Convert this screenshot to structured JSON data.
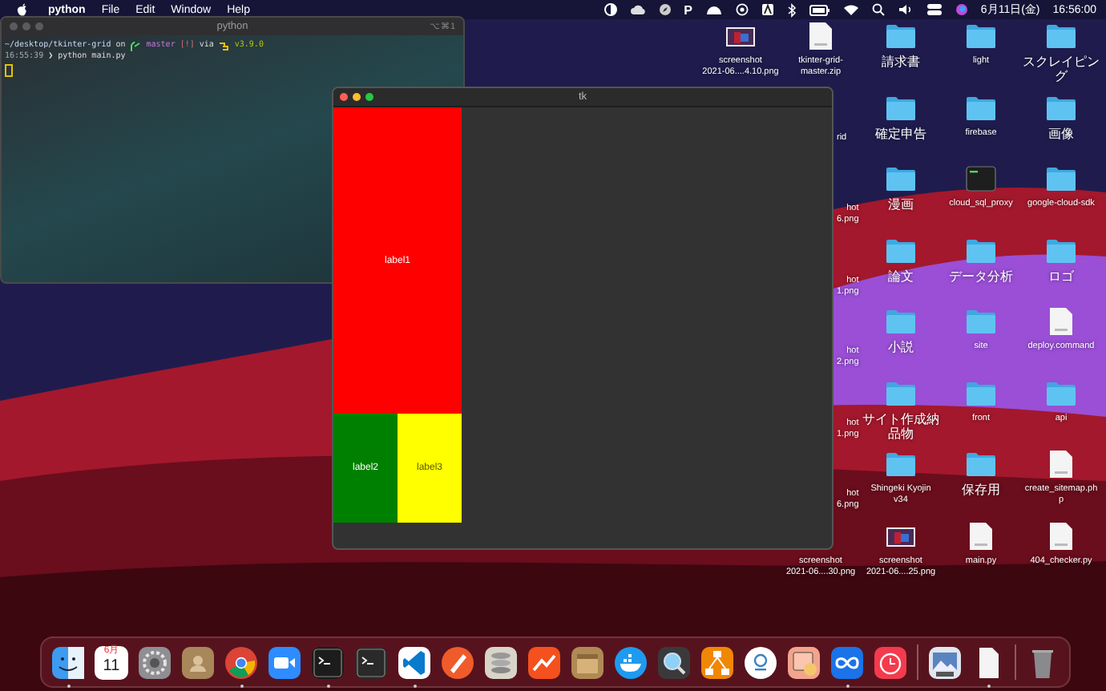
{
  "menu_bar": {
    "app_name": "python",
    "menus": [
      "File",
      "Edit",
      "Window",
      "Help"
    ],
    "status_letter": "P",
    "date": "6月11日(金)",
    "time": "16:56:00"
  },
  "terminal": {
    "title": "python",
    "shortcut": "⌥⌘1",
    "prompt": {
      "path": "~/desktop/tkinter-grid",
      "on": "on",
      "branch": "master",
      "status": "[!]",
      "via": "via",
      "version": "v3.9.0"
    },
    "command_line": {
      "time": "16:55:39",
      "arrow": "❯",
      "command": "python main.py"
    }
  },
  "tk_window": {
    "title": "tk",
    "labels": [
      {
        "text": "label1",
        "color": "#ff0000"
      },
      {
        "text": "label2",
        "color": "#008000"
      },
      {
        "text": "label3",
        "color": "#ffff00"
      }
    ]
  },
  "desktop_rows": [
    [
      {
        "kind": "image",
        "label": "screenshot\n2021-06....4.10.png"
      },
      {
        "kind": "zip",
        "label": "tkinter-grid-\nmaster.zip"
      },
      {
        "kind": "folder",
        "label": "請求書"
      },
      {
        "kind": "folder",
        "label": "light"
      },
      {
        "kind": "folder",
        "label": "スクレイピング"
      }
    ],
    [
      {
        "kind": "partial",
        "label": "rid"
      },
      {
        "kind": "folder",
        "label": "確定申告"
      },
      {
        "kind": "folder",
        "label": "firebase"
      },
      {
        "kind": "folder",
        "label": "画像"
      }
    ],
    [
      {
        "kind": "partial",
        "label": "hot\n6.png"
      },
      {
        "kind": "folder",
        "label": "漫画"
      },
      {
        "kind": "terminal",
        "label": "cloud_sql_proxy"
      },
      {
        "kind": "folder",
        "label": "google-cloud-sdk"
      }
    ],
    [
      {
        "kind": "partial",
        "label": "hot\n1.png"
      },
      {
        "kind": "folder",
        "label": "論文"
      },
      {
        "kind": "folder",
        "label": "データ分析"
      },
      {
        "kind": "folder",
        "label": "ロゴ"
      }
    ],
    [
      {
        "kind": "partial",
        "label": "hot\n2.png"
      },
      {
        "kind": "folder",
        "label": "小説"
      },
      {
        "kind": "folder",
        "label": "site"
      },
      {
        "kind": "document",
        "label": "deploy.command"
      }
    ],
    [
      {
        "kind": "partial",
        "label": "hot\n1.png"
      },
      {
        "kind": "folder",
        "label": "サイト作成納品物"
      },
      {
        "kind": "folder",
        "label": "front"
      },
      {
        "kind": "folder",
        "label": "api"
      }
    ],
    [
      {
        "kind": "partial",
        "label": "hot\n6.png"
      },
      {
        "kind": "folder",
        "label": "Shingeki Kyojin\nv34"
      },
      {
        "kind": "folder",
        "label": "保存用"
      },
      {
        "kind": "document",
        "label": "create_sitemap.ph\np"
      }
    ],
    [
      {
        "kind": "caption",
        "label": "screenshot\n2021-06....30.png"
      },
      {
        "kind": "image",
        "label": "screenshot\n2021-06....25.png"
      },
      {
        "kind": "document",
        "label": "main.py"
      },
      {
        "kind": "document",
        "label": "404_checker.py"
      }
    ]
  ],
  "dock": [
    {
      "kind": "finder",
      "running": true,
      "color": "#3d9bf0"
    },
    {
      "kind": "calendar",
      "running": false,
      "color": "#ffffff",
      "month": "6月",
      "day": "11"
    },
    {
      "kind": "gear",
      "running": false,
      "color": "#8e8e93"
    },
    {
      "kind": "contacts",
      "running": false,
      "color": "#a8875a"
    },
    {
      "kind": "browser",
      "running": true,
      "color": "#db4437"
    },
    {
      "kind": "camera",
      "running": false,
      "color": "#2d8cff"
    },
    {
      "kind": "terminal",
      "running": true,
      "color": "#1c1c1c"
    },
    {
      "kind": "terminal",
      "running": false,
      "color": "#2a2a2a"
    },
    {
      "kind": "code",
      "running": true,
      "color": "#ffffff"
    },
    {
      "kind": "pen",
      "running": false,
      "color": "#ef5b2b"
    },
    {
      "kind": "stack",
      "running": false,
      "color": "#d8d4c8"
    },
    {
      "kind": "chart",
      "running": false,
      "color": "#f4511e"
    },
    {
      "kind": "box",
      "running": false,
      "color": "#b08a55"
    },
    {
      "kind": "whale",
      "running": false,
      "color": "#1d9bf0"
    },
    {
      "kind": "magnifier",
      "running": false,
      "color": "#3a3a3c"
    },
    {
      "kind": "diagram",
      "running": false,
      "color": "#f08705"
    },
    {
      "kind": "ring",
      "running": false,
      "color": "#ffffff"
    },
    {
      "kind": "image",
      "running": false,
      "color": "#f2a48c"
    },
    {
      "kind": "infinity",
      "running": true,
      "color": "#1a73e8"
    },
    {
      "kind": "clock",
      "running": false,
      "color": "#f43b4e"
    },
    {
      "kind": "separator"
    },
    {
      "kind": "photo",
      "running": false,
      "color": "#dfe6ee"
    },
    {
      "kind": "document",
      "running": true,
      "color": "#f4f4f4"
    },
    {
      "kind": "separator"
    },
    {
      "kind": "trash",
      "running": false,
      "color": "#8a8a8e"
    }
  ]
}
